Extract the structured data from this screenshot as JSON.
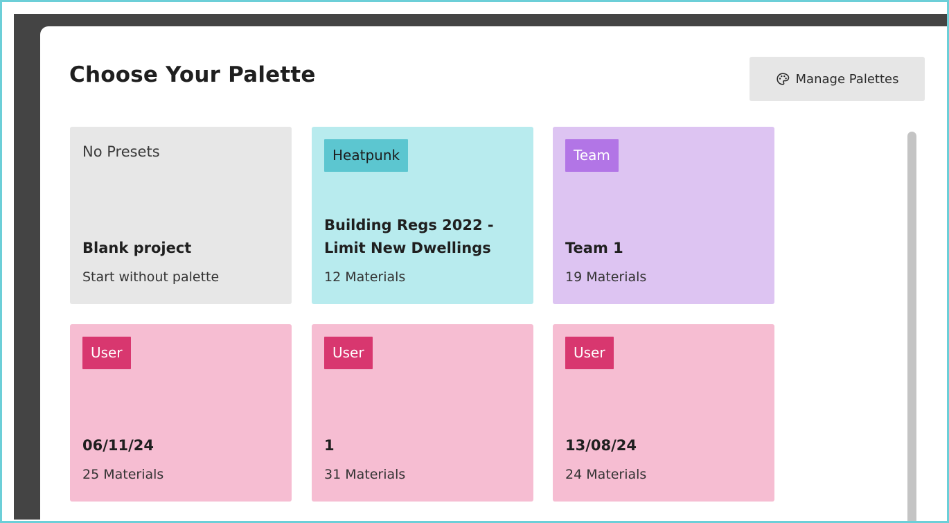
{
  "header": {
    "title": "Choose Your Palette",
    "manage_button_label": "Manage Palettes",
    "manage_button_icon": "palette-icon"
  },
  "palettes": [
    {
      "tag": "No Presets",
      "name": "Blank project",
      "subtitle": "Start without palette",
      "type": "none",
      "color": "#e7e7e7"
    },
    {
      "tag": "Heatpunk",
      "name": "Building Regs 2022 - Limit New Dwellings",
      "subtitle": "12 Materials",
      "type": "heatpunk",
      "color": "#b8ebee"
    },
    {
      "tag": "Team",
      "name": "Team 1",
      "subtitle": "19 Materials",
      "type": "team",
      "color": "#ddc4f2"
    },
    {
      "tag": "User",
      "name": "06/11/24",
      "subtitle": "25 Materials",
      "type": "user",
      "color": "#f6bdd2"
    },
    {
      "tag": "User",
      "name": "1",
      "subtitle": "31 Materials",
      "type": "user",
      "color": "#f6bdd2"
    },
    {
      "tag": "User",
      "name": "13/08/24",
      "subtitle": "24 Materials",
      "type": "user",
      "color": "#f6bdd2"
    }
  ],
  "colors": {
    "heatpunk_tag": "#5cc6d0",
    "team_tag": "#b275e6",
    "user_tag": "#d8376f",
    "frame_border": "#6ccfd8"
  }
}
